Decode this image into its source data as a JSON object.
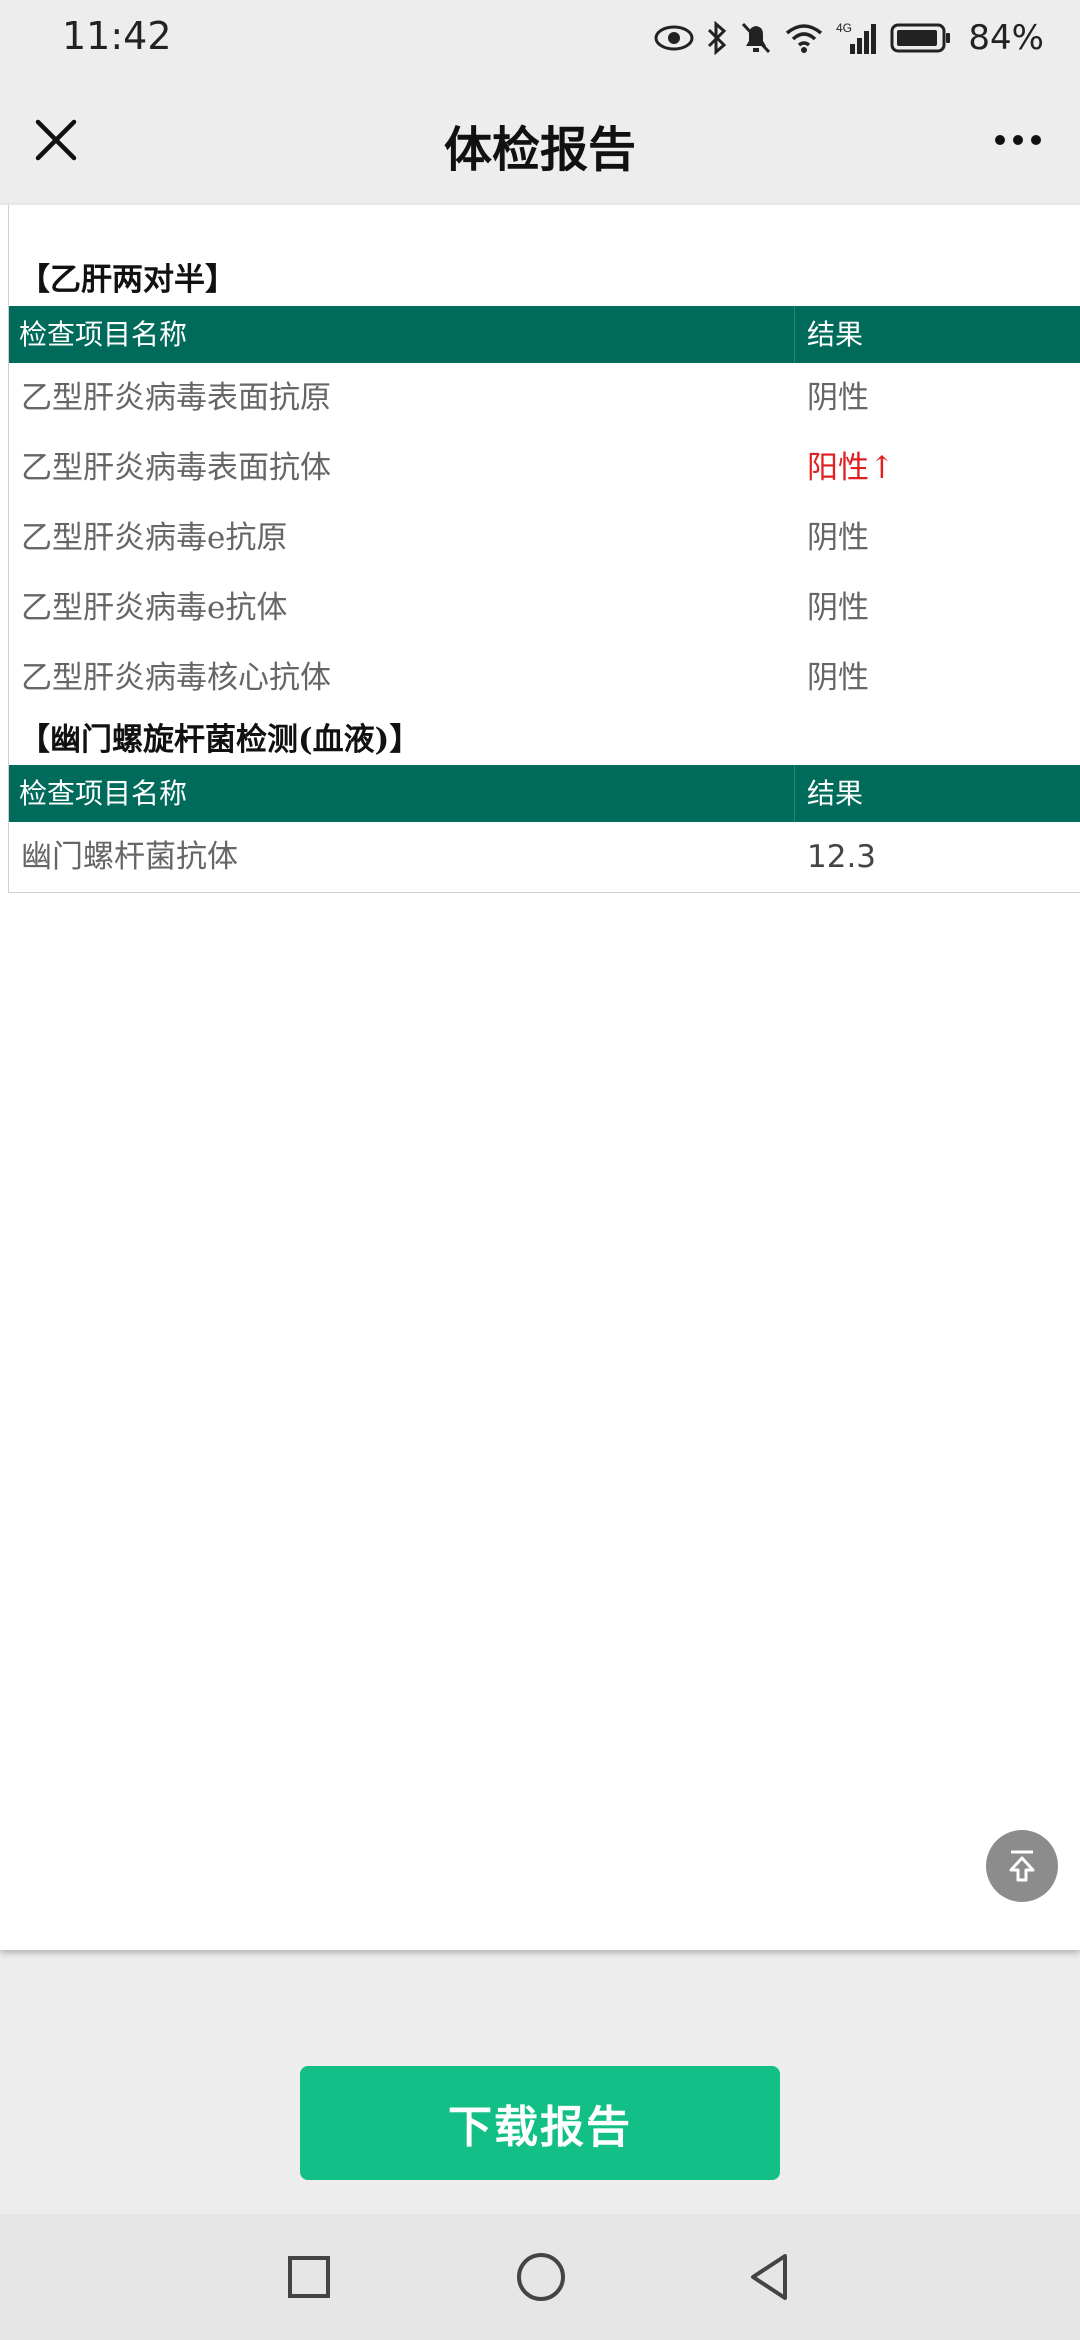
{
  "status_bar": {
    "time": "11:42",
    "network": "4G",
    "battery_percent": "84%",
    "icons": [
      "eye-icon",
      "bluetooth-icon",
      "mute-bell-icon",
      "wifi-icon",
      "signal-icon",
      "battery-icon"
    ]
  },
  "nav": {
    "title": "体检报告",
    "close_icon": "close-icon",
    "more_icon": "more-icon"
  },
  "report": {
    "sections": [
      {
        "title": "【乙肝两对半】",
        "header_name": "检查项目名称",
        "header_result": "结果",
        "rows": [
          {
            "name": "乙型肝炎病毒表面抗原",
            "result": "阴性"
          },
          {
            "name": "乙型肝炎病毒表面抗体",
            "result": "阳性↑"
          },
          {
            "name": "乙型肝炎病毒e抗原",
            "result": "阴性"
          },
          {
            "name": "乙型肝炎病毒e抗体",
            "result": "阴性"
          },
          {
            "name": "乙型肝炎病毒核心抗体",
            "result": "阴性"
          }
        ]
      },
      {
        "title": "【幽门螺旋杆菌检测(血液)】",
        "header_name": "检查项目名称",
        "header_result": "结果",
        "rows": [
          {
            "name": "幽门螺杆菌抗体",
            "result": "12.3"
          }
        ]
      }
    ]
  },
  "back_to_top_icon": "back-to-top-icon",
  "download_button": "下载报告",
  "colors": {
    "header_green": "#006b5a",
    "button_green": "#12bf86",
    "abnormal_red": "#e02020"
  },
  "system_nav": [
    "square-recents-icon",
    "circle-home-icon",
    "triangle-back-icon"
  ]
}
